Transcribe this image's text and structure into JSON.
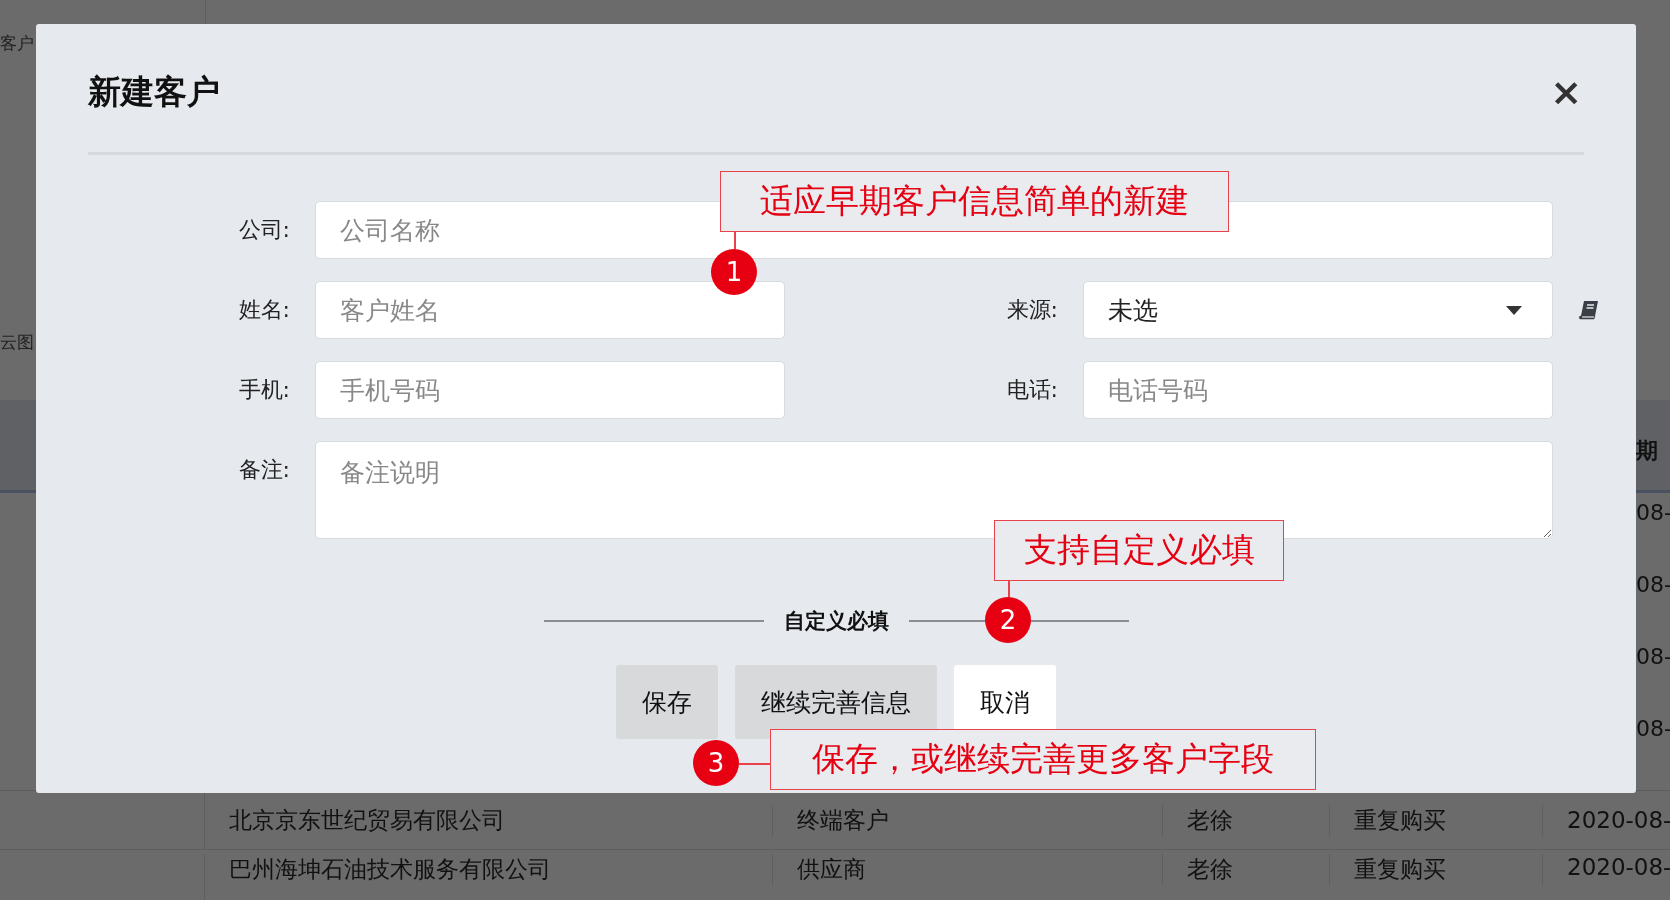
{
  "background": {
    "left_fragments": [
      "客户",
      "云图"
    ],
    "header_fragment": "期",
    "right_fragments": [
      "08-",
      "08-",
      "08-",
      "08-"
    ],
    "rows": [
      {
        "cells": [
          "北京京东世纪贸易有限公司",
          "终端客户",
          "老徐",
          "重复购买",
          "2020-08-"
        ]
      },
      {
        "cells": [
          "巴州海坤石油技术服务有限公司",
          "供应商",
          "老徐",
          "重复购买",
          "2020-08-"
        ]
      }
    ]
  },
  "dialog": {
    "title": "新建客户",
    "close": "×",
    "form": {
      "rows": [
        [
          {
            "kind": "text",
            "label": "公司:",
            "placeholder": "公司名称"
          }
        ],
        [
          {
            "kind": "text",
            "label": "姓名:",
            "placeholder": "客户姓名"
          },
          {
            "kind": "select",
            "label": "来源:",
            "value": "未选"
          }
        ],
        [
          {
            "kind": "text",
            "label": "手机:",
            "placeholder": "手机号码"
          },
          {
            "kind": "text",
            "label": "电话:",
            "placeholder": "电话号码"
          }
        ],
        [
          {
            "kind": "textarea",
            "label": "备注:",
            "placeholder": "备注说明"
          }
        ]
      ]
    },
    "section_divider": "自定义必填",
    "buttons": [
      {
        "label": "保存",
        "kind": "secondary"
      },
      {
        "label": "继续完善信息",
        "kind": "secondary"
      },
      {
        "label": "取消",
        "kind": "plain"
      }
    ]
  },
  "annotations": [
    {
      "number": "1",
      "text": "适应早期客户信息简单的新建"
    },
    {
      "number": "2",
      "text": "支持自定义必填"
    },
    {
      "number": "3",
      "text": "保存，或继续完善更多客户字段"
    }
  ]
}
